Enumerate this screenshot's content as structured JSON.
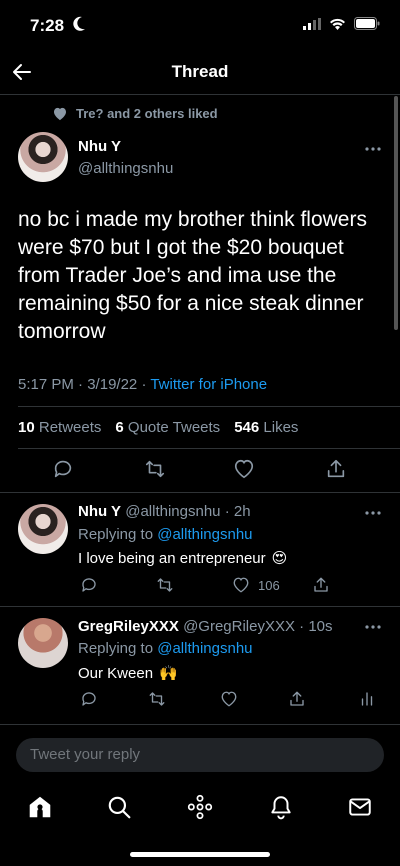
{
  "status_bar": {
    "time": "7:28"
  },
  "nav": {
    "title": "Thread"
  },
  "liked_by": "Tre? and 2 others liked",
  "main_tweet": {
    "name": "Nhu Y",
    "handle": "@allthingsnhu",
    "text": "no bc i made my brother think flowers were $70 but I got the $20 bouquet from Trader Joe’s and ima use the remaining $50 for a nice steak dinner tomorrow",
    "time": "5:17 PM",
    "date": "3/19/22",
    "source": "Twitter for iPhone",
    "retweets_count": "10",
    "retweets_label": "Retweets",
    "quotes_count": "6",
    "quotes_label": "Quote Tweets",
    "likes_count": "546",
    "likes_label": "Likes"
  },
  "replies": [
    {
      "name": "Nhu Y",
      "handle": "@allthingsnhu",
      "time": "2h",
      "replying_prefix": "Replying to",
      "replying_to": "@allthingsnhu",
      "text": "I love being an entrepreneur",
      "emoji": "😍",
      "likes": "106"
    },
    {
      "name": "GregRileyXXX",
      "handle": "@GregRileyXXX",
      "time": "10s",
      "replying_prefix": "Replying to",
      "replying_to": "@allthingsnhu",
      "text": "Our Kween",
      "emoji": "🙌"
    }
  ],
  "composer": {
    "placeholder": "Tweet your reply"
  },
  "tabs": [
    "home-icon",
    "search-icon",
    "spaces-icon",
    "notifications-icon",
    "messages-icon"
  ],
  "colors": {
    "accent": "#1d9bf0",
    "background": "#000000",
    "muted": "#8b98a5",
    "divider": "#2f3336"
  }
}
